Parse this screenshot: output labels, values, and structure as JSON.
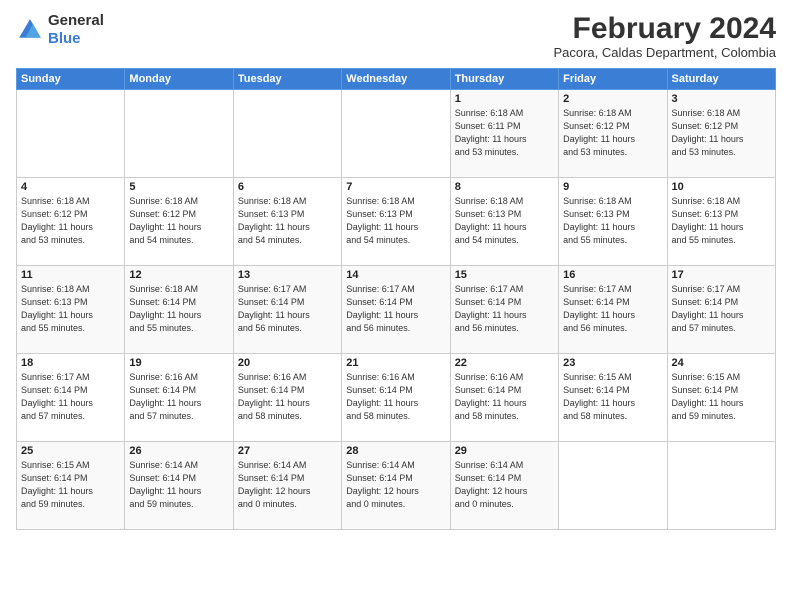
{
  "logo": {
    "general": "General",
    "blue": "Blue"
  },
  "header": {
    "month_year": "February 2024",
    "location": "Pacora, Caldas Department, Colombia"
  },
  "weekdays": [
    "Sunday",
    "Monday",
    "Tuesday",
    "Wednesday",
    "Thursday",
    "Friday",
    "Saturday"
  ],
  "weeks": [
    [
      {
        "day": "",
        "info": ""
      },
      {
        "day": "",
        "info": ""
      },
      {
        "day": "",
        "info": ""
      },
      {
        "day": "",
        "info": ""
      },
      {
        "day": "1",
        "info": "Sunrise: 6:18 AM\nSunset: 6:11 PM\nDaylight: 11 hours\nand 53 minutes."
      },
      {
        "day": "2",
        "info": "Sunrise: 6:18 AM\nSunset: 6:12 PM\nDaylight: 11 hours\nand 53 minutes."
      },
      {
        "day": "3",
        "info": "Sunrise: 6:18 AM\nSunset: 6:12 PM\nDaylight: 11 hours\nand 53 minutes."
      }
    ],
    [
      {
        "day": "4",
        "info": "Sunrise: 6:18 AM\nSunset: 6:12 PM\nDaylight: 11 hours\nand 53 minutes."
      },
      {
        "day": "5",
        "info": "Sunrise: 6:18 AM\nSunset: 6:12 PM\nDaylight: 11 hours\nand 54 minutes."
      },
      {
        "day": "6",
        "info": "Sunrise: 6:18 AM\nSunset: 6:13 PM\nDaylight: 11 hours\nand 54 minutes."
      },
      {
        "day": "7",
        "info": "Sunrise: 6:18 AM\nSunset: 6:13 PM\nDaylight: 11 hours\nand 54 minutes."
      },
      {
        "day": "8",
        "info": "Sunrise: 6:18 AM\nSunset: 6:13 PM\nDaylight: 11 hours\nand 54 minutes."
      },
      {
        "day": "9",
        "info": "Sunrise: 6:18 AM\nSunset: 6:13 PM\nDaylight: 11 hours\nand 55 minutes."
      },
      {
        "day": "10",
        "info": "Sunrise: 6:18 AM\nSunset: 6:13 PM\nDaylight: 11 hours\nand 55 minutes."
      }
    ],
    [
      {
        "day": "11",
        "info": "Sunrise: 6:18 AM\nSunset: 6:13 PM\nDaylight: 11 hours\nand 55 minutes."
      },
      {
        "day": "12",
        "info": "Sunrise: 6:18 AM\nSunset: 6:14 PM\nDaylight: 11 hours\nand 55 minutes."
      },
      {
        "day": "13",
        "info": "Sunrise: 6:17 AM\nSunset: 6:14 PM\nDaylight: 11 hours\nand 56 minutes."
      },
      {
        "day": "14",
        "info": "Sunrise: 6:17 AM\nSunset: 6:14 PM\nDaylight: 11 hours\nand 56 minutes."
      },
      {
        "day": "15",
        "info": "Sunrise: 6:17 AM\nSunset: 6:14 PM\nDaylight: 11 hours\nand 56 minutes."
      },
      {
        "day": "16",
        "info": "Sunrise: 6:17 AM\nSunset: 6:14 PM\nDaylight: 11 hours\nand 56 minutes."
      },
      {
        "day": "17",
        "info": "Sunrise: 6:17 AM\nSunset: 6:14 PM\nDaylight: 11 hours\nand 57 minutes."
      }
    ],
    [
      {
        "day": "18",
        "info": "Sunrise: 6:17 AM\nSunset: 6:14 PM\nDaylight: 11 hours\nand 57 minutes."
      },
      {
        "day": "19",
        "info": "Sunrise: 6:16 AM\nSunset: 6:14 PM\nDaylight: 11 hours\nand 57 minutes."
      },
      {
        "day": "20",
        "info": "Sunrise: 6:16 AM\nSunset: 6:14 PM\nDaylight: 11 hours\nand 58 minutes."
      },
      {
        "day": "21",
        "info": "Sunrise: 6:16 AM\nSunset: 6:14 PM\nDaylight: 11 hours\nand 58 minutes."
      },
      {
        "day": "22",
        "info": "Sunrise: 6:16 AM\nSunset: 6:14 PM\nDaylight: 11 hours\nand 58 minutes."
      },
      {
        "day": "23",
        "info": "Sunrise: 6:15 AM\nSunset: 6:14 PM\nDaylight: 11 hours\nand 58 minutes."
      },
      {
        "day": "24",
        "info": "Sunrise: 6:15 AM\nSunset: 6:14 PM\nDaylight: 11 hours\nand 59 minutes."
      }
    ],
    [
      {
        "day": "25",
        "info": "Sunrise: 6:15 AM\nSunset: 6:14 PM\nDaylight: 11 hours\nand 59 minutes."
      },
      {
        "day": "26",
        "info": "Sunrise: 6:14 AM\nSunset: 6:14 PM\nDaylight: 11 hours\nand 59 minutes."
      },
      {
        "day": "27",
        "info": "Sunrise: 6:14 AM\nSunset: 6:14 PM\nDaylight: 12 hours\nand 0 minutes."
      },
      {
        "day": "28",
        "info": "Sunrise: 6:14 AM\nSunset: 6:14 PM\nDaylight: 12 hours\nand 0 minutes."
      },
      {
        "day": "29",
        "info": "Sunrise: 6:14 AM\nSunset: 6:14 PM\nDaylight: 12 hours\nand 0 minutes."
      },
      {
        "day": "",
        "info": ""
      },
      {
        "day": "",
        "info": ""
      }
    ]
  ]
}
